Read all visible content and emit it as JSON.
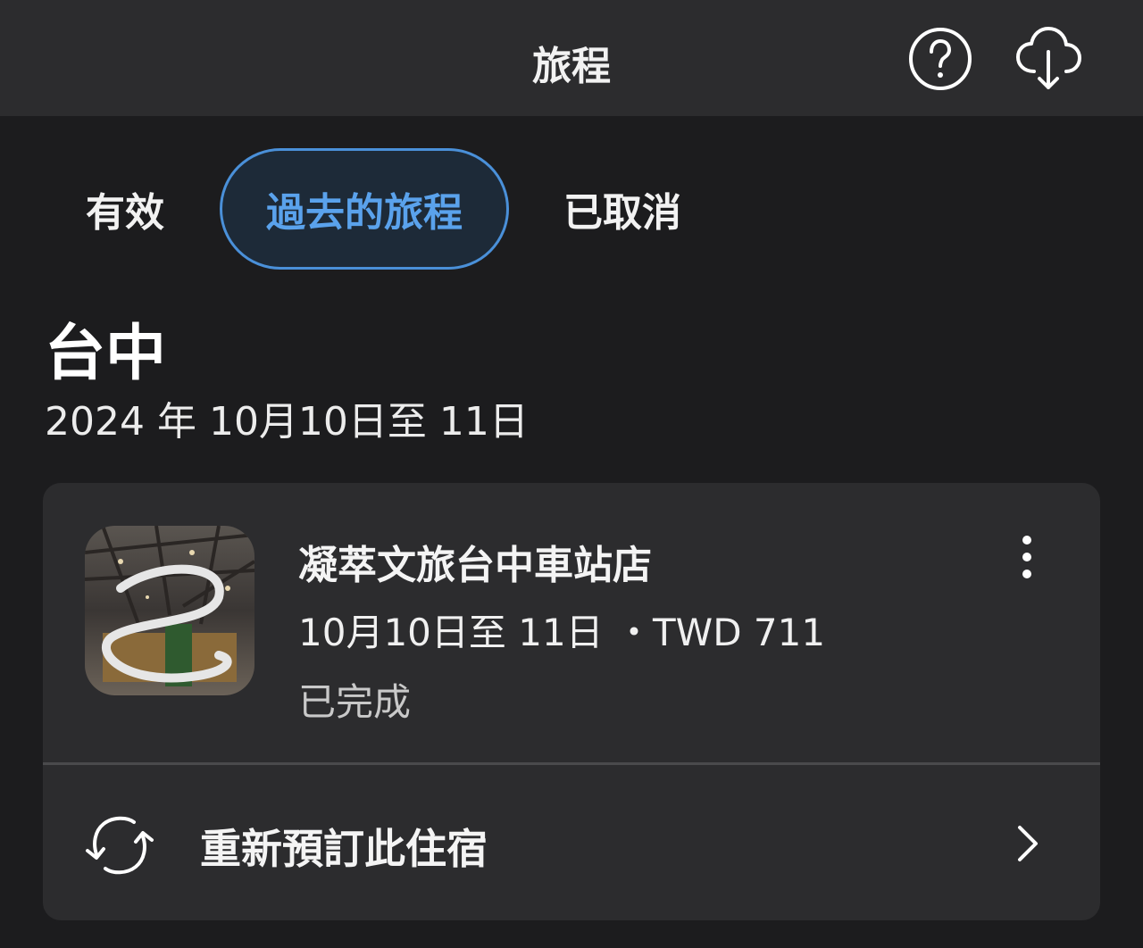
{
  "header": {
    "title": "旅程"
  },
  "tabs": [
    {
      "label": "有效"
    },
    {
      "label": "過去的旅程"
    },
    {
      "label": "已取消"
    }
  ],
  "trip": {
    "city": "台中",
    "dates": "2024 年 10月10日至 11日"
  },
  "booking": {
    "hotel_name": "凝萃文旅台中車站店",
    "stay_line": "10月10日至 11日 ・TWD 711",
    "status": "已完成",
    "rebook_label": "重新預訂此住宿"
  },
  "colors": {
    "background": "#1c1c1e",
    "header_bg": "#2c2c2e",
    "card_bg": "#2c2c2e",
    "accent": "#4a90d9",
    "accent_text": "#5aa2ec"
  },
  "icons": {
    "help": "question-circle-icon",
    "download": "cloud-download-icon",
    "more": "more-vertical-icon",
    "rebook": "refresh-icon",
    "chevron": "chevron-right-icon"
  }
}
